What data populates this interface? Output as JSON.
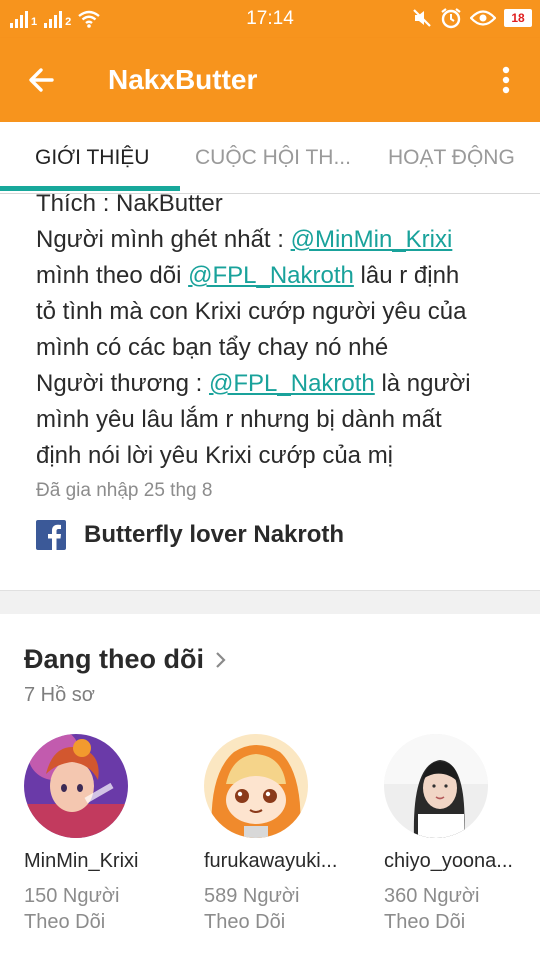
{
  "status_bar": {
    "time": "17:14",
    "battery": "18",
    "carrier1": "1",
    "carrier2": "2"
  },
  "app_bar": {
    "title": "NakxButter"
  },
  "tabs": [
    {
      "label": "GIỚI THIỆU",
      "active": true
    },
    {
      "label": "CUỘC HỘI TH...",
      "active": false
    },
    {
      "label": "HOẠT ĐỘNG",
      "active": false
    }
  ],
  "bio": {
    "line1": "Thích : NakButter",
    "line2_pre": "Người mình ghét nhất : ",
    "line2_mention": "@MinMin_Krixi",
    "line3_pre": "mình theo dõi ",
    "line3_mention": "@FPL_Nakroth",
    "line3_post": " lâu r định",
    "line4": "tỏ tình mà con Krixi cướp người yêu của",
    "line5": "mình có các bạn tẩy chay nó nhé",
    "line6_pre": "Người thương : ",
    "line6_mention": "@FPL_Nakroth",
    "line6_post": " là người",
    "line7": "mình yêu lâu lắm r nhưng bị dành mất",
    "line8": "định nói lời yêu Krixi cướp của mị",
    "joined": "Đã gia nhập 25 thg 8",
    "facebook_name": "Butterfly lover Nakroth"
  },
  "following": {
    "title": "Đang theo dõi",
    "count": "7 Hồ sơ",
    "profiles": [
      {
        "name": "MinMin_Krixi",
        "followers_line1": "150 Người",
        "followers_line2": "Theo Dõi"
      },
      {
        "name": "furukawayuki...",
        "followers_line1": "589 Người",
        "followers_line2": "Theo Dõi"
      },
      {
        "name": "chiyo_yoona...",
        "followers_line1": "360 Người",
        "followers_line2": "Theo Dõi"
      }
    ]
  },
  "colors": {
    "brand": "#f7941d",
    "accent": "#17a89b",
    "mention": "#19a29b",
    "facebook": "#3b5998"
  }
}
